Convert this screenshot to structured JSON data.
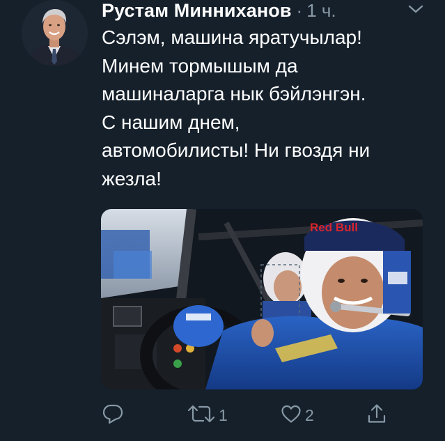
{
  "tweet": {
    "author_name": "Рустам Минниханов",
    "separator": "·",
    "timestamp": "1 ч.",
    "text_lines": [
      "Сэлэм, машина яратучылар!",
      "Минем тормышым да",
      "машиналарга нык бэйлэнгэн.",
      "С нашим днем,",
      "автомобилисты! Ни гвоздя ни",
      "жезла!"
    ],
    "media": {
      "helmet_brand": "Red Bull"
    },
    "actions": {
      "reply_icon": "reply-icon",
      "retweet_icon": "retweet-icon",
      "retweet_count": "1",
      "like_icon": "heart-icon",
      "like_count": "2",
      "share_icon": "share-icon"
    }
  },
  "colors": {
    "background": "#15202b",
    "text": "#ffffff",
    "muted": "#8899a6"
  }
}
